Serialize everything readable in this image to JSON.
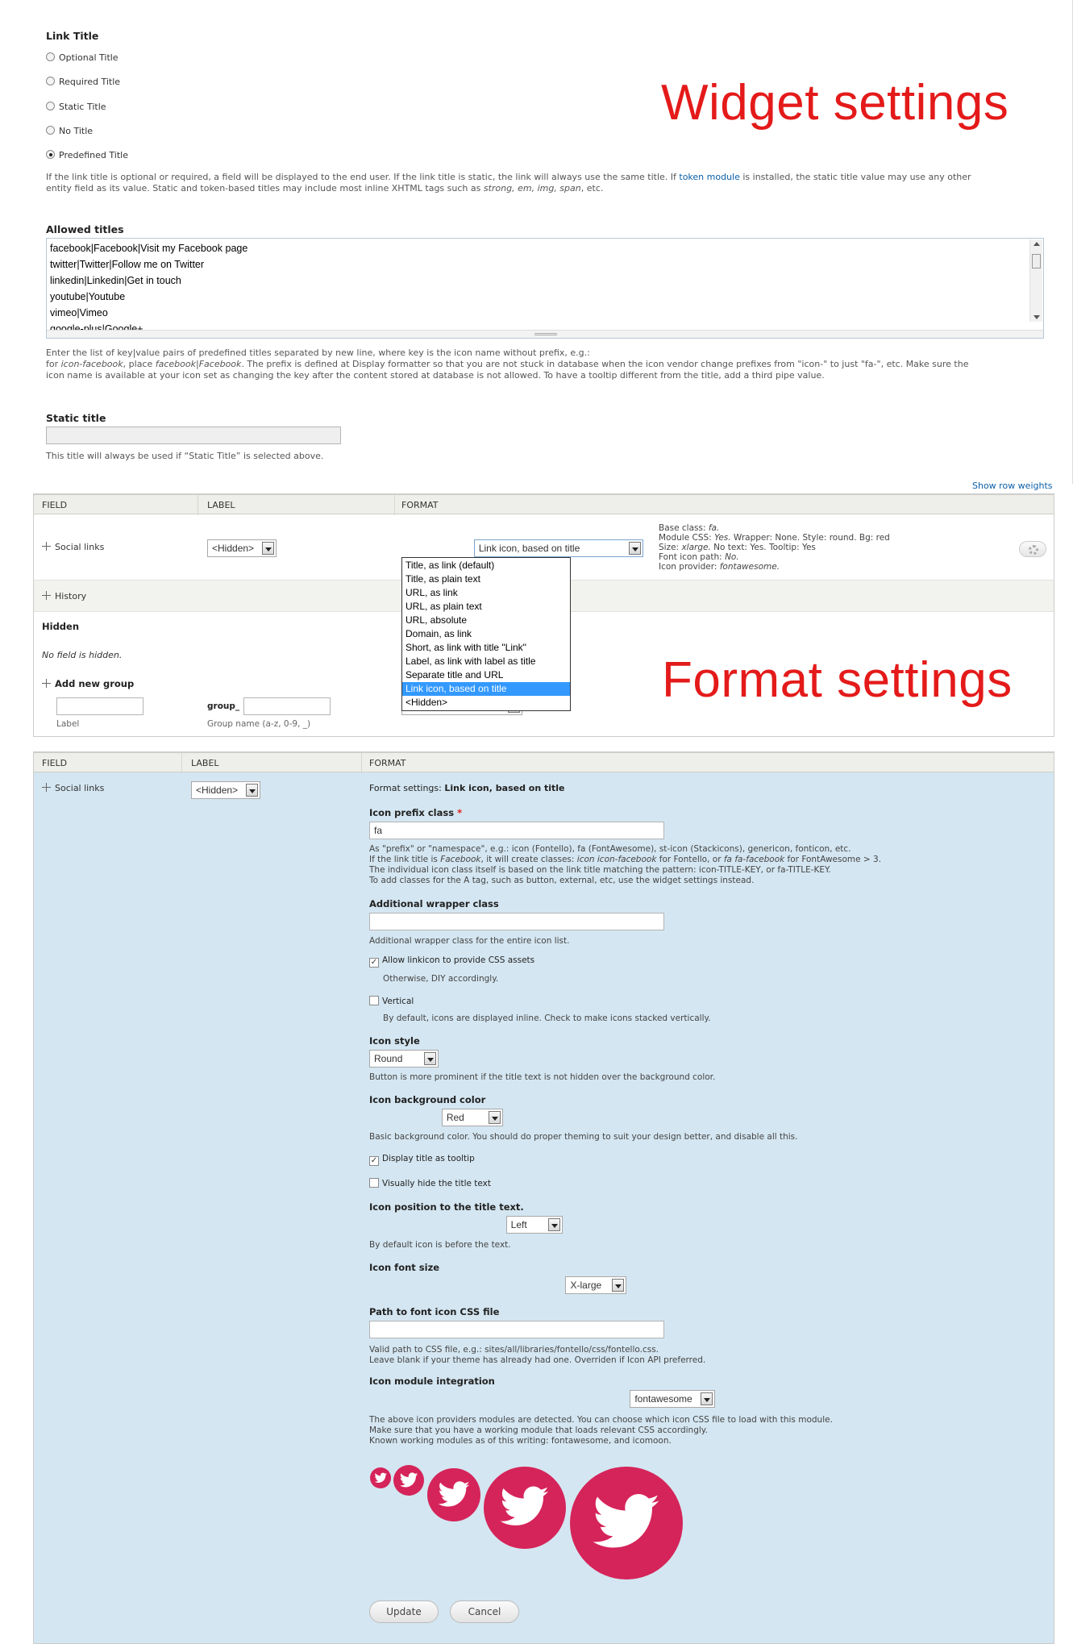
{
  "widget": {
    "link_title_label": "Link Title",
    "options": [
      {
        "label": "Optional Title",
        "selected": false
      },
      {
        "label": "Required Title",
        "selected": false
      },
      {
        "label": "Static Title",
        "selected": false
      },
      {
        "label": "No Title",
        "selected": false
      },
      {
        "label": "Predefined Title",
        "selected": true
      }
    ],
    "desc_a": "If the link title is optional or required, a field will be displayed to the end user. If the link title is static, the link will always use the same title. If ",
    "desc_link": "token module",
    "desc_b": " is installed, the static title value may use any other",
    "desc_c": "entity field as its value. Static and token-based titles may include most inline XHTML tags such as ",
    "desc_tags": "strong, em, img, span",
    "desc_d": ", etc.",
    "allowed_label": "Allowed titles",
    "allowed_lines": [
      "facebook|Facebook|Visit my Facebook page",
      "twitter|Twitter|Follow me on Twitter",
      "linkedin|Linkedin|Get in touch",
      "youtube|Youtube",
      "vimeo|Vimeo",
      "google-plus|Google+"
    ],
    "allowed_help_1": "Enter the list of key|value pairs of predefined titles separated by new line, where key is the icon name without prefix, e.g.:",
    "allowed_help_2a": "for ",
    "allowed_help_2b": "icon-facebook",
    "allowed_help_2c": ", place ",
    "allowed_help_2d": "facebook|Facebook",
    "allowed_help_2e": ". The prefix is defined at Display formatter so that you are not stuck in database when the icon vendor change prefixes from \"icon-\" to just \"fa-\", etc. Make sure the",
    "allowed_help_3": "icon name is available at your icon set as changing the key after the content stored at database is not allowed. To have a tooltip different from the title, add a third pipe value.",
    "static_label": "Static title",
    "static_help": "This title will always be used if “Static Title” is selected above.",
    "banner": "Widget settings"
  },
  "fields_table": {
    "row_weights": "Show row weights",
    "headers": [
      "FIELD",
      "LABEL",
      "FORMAT"
    ],
    "row_field": "Social links",
    "row_label_select": "<Hidden>",
    "row_format_select": "Link icon, based on title",
    "summary": {
      "l1a": "Base class: ",
      "l1b": "fa.",
      "l2a": "Module CSS: ",
      "l2b": "Yes.",
      "l2c": " Wrapper: None. Style: round. Bg: red",
      "l3a": "Size: ",
      "l3b": "xlarge.",
      "l3c": " No text: Yes. Tooltip: Yes",
      "l4a": "Font icon path: ",
      "l4b": "No.",
      "l5a": "Icon provider: ",
      "l5b": "fontawesome."
    },
    "dropdown_options": [
      "Title, as link (default)",
      "Title, as plain text",
      "URL, as link",
      "URL, as plain text",
      "URL, absolute",
      "Domain, as link",
      "Short, as link with title \"Link\"",
      "Label, as link with label as title",
      "Separate title and URL",
      "Link icon, based on title",
      "<Hidden>"
    ],
    "dropdown_selected_index": 9,
    "history_label": "History",
    "hidden_heading": "Hidden",
    "no_field_hidden": "No field is hidden.",
    "add_group_label": "Add new group",
    "group_prefix": "group_",
    "label_caption": "Label",
    "group_caption": "Group name (a-z, 0-9, _)",
    "banner": "Format settings"
  },
  "format_panel": {
    "headers": [
      "FIELD",
      "LABEL",
      "FORMAT"
    ],
    "row_field": "Social links",
    "row_label_select": "<Hidden>",
    "intro_a": "Format settings: ",
    "intro_b": "Link icon, based on title",
    "prefix_label": "Icon prefix class",
    "prefix_required": "*",
    "prefix_value": "fa",
    "prefix_help_1": "As \"prefix\" or \"namespace\", e.g.: icon (Fontello), fa (FontAwesome), st-icon (Stackicons), genericon, fonticon, etc.",
    "prefix_help_2a": "If the link title is ",
    "prefix_help_2b": "Facebook",
    "prefix_help_2c": ", it will create classes: ",
    "prefix_help_2d": "icon icon-facebook",
    "prefix_help_2e": " for Fontello, or ",
    "prefix_help_2f": "fa fa-facebook",
    "prefix_help_2g": " for FontAwesome > 3.",
    "prefix_help_3": "The individual icon class itself is based on the link title matching the pattern: icon-TITLE-KEY, or fa-TITLE-KEY.",
    "prefix_help_4": "To add classes for the A tag, such as button, external, etc, use the widget settings instead.",
    "wrapper_label": "Additional wrapper class",
    "wrapper_help": "Additional wrapper class for the entire icon list.",
    "allow_css_label": "Allow linkicon to provide CSS assets",
    "allow_css_checked": true,
    "allow_css_help": "Otherwise, DIY accordingly.",
    "vertical_label": "Vertical",
    "vertical_checked": false,
    "vertical_help": "By default, icons are displayed inline. Check to make icons stacked vertically.",
    "style_label": "Icon style",
    "style_value": "Round",
    "style_help": "Button is more prominent if the title text is not hidden over the background color.",
    "bg_label": "Icon background color",
    "bg_value": "Red",
    "bg_help": "Basic background color. You should do proper theming to suit your design better, and disable all this.",
    "tooltip_label": "Display title as tooltip",
    "tooltip_checked": true,
    "hide_text_label": "Visually hide the title text",
    "hide_text_checked": false,
    "position_label": "Icon position to the title text.",
    "position_value": "Left",
    "position_help": "By default icon is before the text.",
    "size_label": "Icon font size",
    "size_value": "X-large",
    "path_label": "Path to font icon CSS file",
    "path_help_1": "Valid path to CSS file, e.g.: sites/all/libraries/fontello/css/fontello.css.",
    "path_help_2": "Leave blank if your theme has already had one. Overriden if Icon API preferred.",
    "module_label": "Icon module integration",
    "module_value": "fontawesome",
    "module_help_1": "The above icon providers modules are detected. You can choose which icon CSS file to load with this module.",
    "module_help_2": "Make sure that you have a working module that loads relevant CSS accordingly.",
    "module_help_3": "Known working modules as of this writing: fontawesome, and icomoon.",
    "update_button": "Update",
    "cancel_button": "Cancel"
  },
  "colors": {
    "banner_red": "#e41a1a",
    "panel_blue": "#d4e6f1",
    "twitter_pink": "#d5245a",
    "link_blue": "#0b5fa8",
    "select_highlight": "#3399ff"
  }
}
